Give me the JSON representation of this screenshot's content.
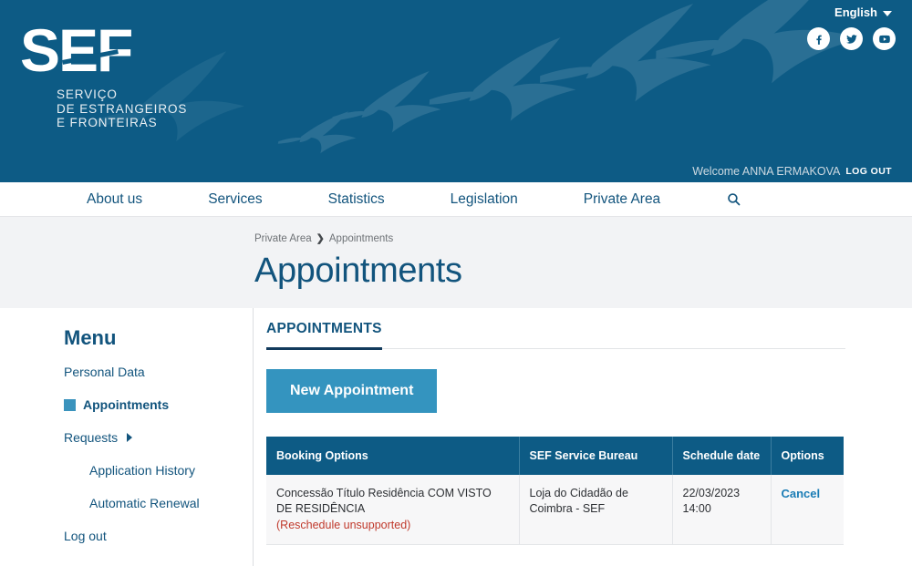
{
  "header": {
    "logo_main": "SEF",
    "logo_sub_line1": "SERVIÇO",
    "logo_sub_line2": "DE ESTRANGEIROS",
    "logo_sub_line3": "E FRONTEIRAS",
    "language": "English",
    "socials": [
      {
        "name": "facebook-icon",
        "label": "Facebook"
      },
      {
        "name": "twitter-icon",
        "label": "Twitter"
      },
      {
        "name": "youtube-icon",
        "label": "YouTube"
      }
    ],
    "welcome_text": "Welcome ANNA ERMAKOVA",
    "logout_label": "LOG OUT",
    "banner_color": "#0d5b85",
    "bird_color": "#2a6f94"
  },
  "nav": {
    "items": [
      {
        "label": "About us"
      },
      {
        "label": "Services"
      },
      {
        "label": "Statistics"
      },
      {
        "label": "Legislation"
      },
      {
        "label": "Private Area"
      }
    ],
    "search_icon": "search-icon"
  },
  "breadcrumb": {
    "parent": "Private Area",
    "separator": "❯",
    "current": "Appointments"
  },
  "page": {
    "title": "Appointments"
  },
  "sidebar": {
    "title": "Menu",
    "items": [
      {
        "label": "Personal Data",
        "active": false,
        "sub": false,
        "chevron": false
      },
      {
        "label": "Appointments",
        "active": true,
        "sub": false,
        "chevron": false
      },
      {
        "label": "Requests",
        "active": false,
        "sub": false,
        "chevron": true
      },
      {
        "label": "Application History",
        "active": false,
        "sub": true,
        "chevron": false
      },
      {
        "label": "Automatic Renewal",
        "active": false,
        "sub": true,
        "chevron": false
      },
      {
        "label": "Log out",
        "active": false,
        "sub": false,
        "chevron": false
      }
    ],
    "active_marker_color": "#3a93bd"
  },
  "main": {
    "tab_label": "APPOINTMENTS",
    "new_appointment_label": "New Appointment",
    "new_appointment_color": "#3494bf",
    "table": {
      "columns": [
        "Booking Options",
        "SEF Service Bureau",
        "Schedule date",
        "Options"
      ],
      "rows": [
        {
          "booking_option": "Concessão Título Residência COM VISTO DE RESIDÊNCIA",
          "booking_note": "(Reschedule unsupported)",
          "bureau": "Loja do Cidadão de Coimbra - SEF",
          "schedule_date": "22/03/2023 14:00",
          "option_action": "Cancel"
        }
      ],
      "header_color": "#0d5b85",
      "note_color": "#c0392b"
    }
  }
}
